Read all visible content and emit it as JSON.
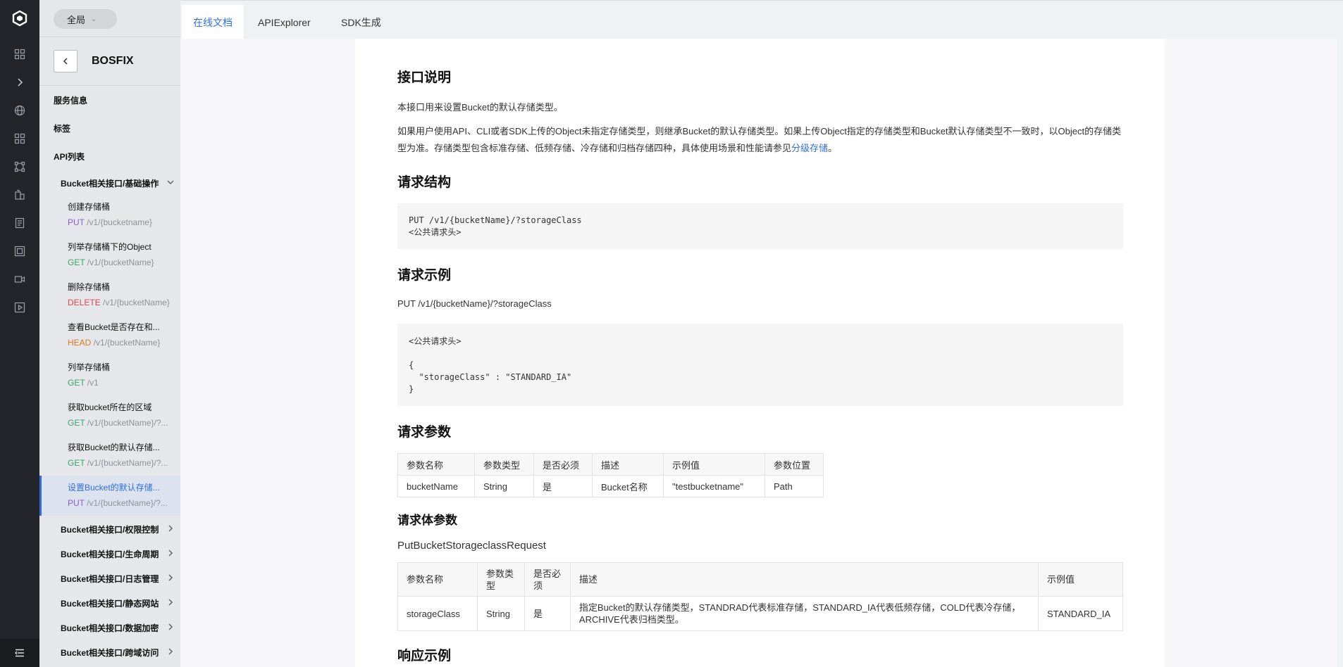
{
  "rail": {
    "icons": [
      "logo-icon",
      "dashboard-icon",
      "expand-icon",
      "globe-icon",
      "grid-icon",
      "network-icon",
      "building-icon",
      "document-icon",
      "storage-icon",
      "video-icon",
      "media-icon"
    ]
  },
  "sidebar": {
    "scope_label": "全局",
    "service_title": "BOSFIX",
    "service_info": "服务信息",
    "tags": "标签",
    "api_list": "API列表",
    "group_basic": "Bucket相关接口/基础操作",
    "apis": [
      {
        "name": "创建存储桶",
        "method": "PUT",
        "path": "/v1/{bucketname}"
      },
      {
        "name": "列举存储桶下的Object",
        "method": "GET",
        "path": "/v1/{bucketName}"
      },
      {
        "name": "删除存储桶",
        "method": "DELETE",
        "path": "/v1/{bucketName}"
      },
      {
        "name": "查看Bucket是否存在和...",
        "method": "HEAD",
        "path": "/v1/{bucketName}"
      },
      {
        "name": "列举存储桶",
        "method": "GET",
        "path": "/v1"
      },
      {
        "name": "获取bucket所在的区域",
        "method": "GET",
        "path": "/v1/{bucketName}/?..."
      },
      {
        "name": "获取Bucket的默认存储...",
        "method": "GET",
        "path": "/v1/{bucketName}/?..."
      },
      {
        "name": "设置Bucket的默认存储...",
        "method": "PUT",
        "path": "/v1/{bucketName}/?..."
      }
    ],
    "groups": [
      "Bucket相关接口/权限控制",
      "Bucket相关接口/生命周期",
      "Bucket相关接口/日志管理",
      "Bucket相关接口/静态网站",
      "Bucket相关接口/数据加密",
      "Bucket相关接口/跨域访问"
    ]
  },
  "tabs": [
    "在线文档",
    "APIExplorer",
    "SDK生成"
  ],
  "doc": {
    "h_desc": "接口说明",
    "desc_1": "本接口用来设置Bucket的默认存储类型。",
    "desc_2_a": "如果用户使用API、CLI或者SDK上传的Object未指定存储类型，则继承Bucket的默认存储类型。如果上传Object指定的存储类型和Bucket默认存储类型不一致时，以Object的存储类型为准。存储类型包含标准存储、低频存储、冷存储和归档存储四种，具体使用场景和性能请参见",
    "desc_2_link": "分级存储",
    "desc_2_b": "。",
    "h_struct": "请求结构",
    "struct_code": "PUT /v1/{bucketName}/?storageClass\n<公共请求头>",
    "h_example": "请求示例",
    "example_line": "PUT /v1/{bucketName}/?storageClass",
    "example_code": "<公共请求头>\n\n{\n  \"storageClass\" : \"STANDARD_IA\"\n}",
    "h_params": "请求参数",
    "params_headers": [
      "参数名称",
      "参数类型",
      "是否必须",
      "描述",
      "示例值",
      "参数位置"
    ],
    "params_row": [
      "bucketName",
      "String",
      "是",
      "Bucket名称",
      "\"testbucketname\"",
      "Path"
    ],
    "h_body": "请求体参数",
    "body_type": "PutBucketStorageclassRequest",
    "body_headers": [
      "参数名称",
      "参数类型",
      "是否必须",
      "描述",
      "示例值"
    ],
    "body_row": [
      "storageClass",
      "String",
      "是",
      "指定Bucket的默认存储类型，STANDRAD代表标准存储，STANDARD_IA代表低频存储，COLD代表冷存储，ARCHIVE代表归档类型。",
      "STANDARD_IA"
    ],
    "h_response": "响应示例"
  }
}
